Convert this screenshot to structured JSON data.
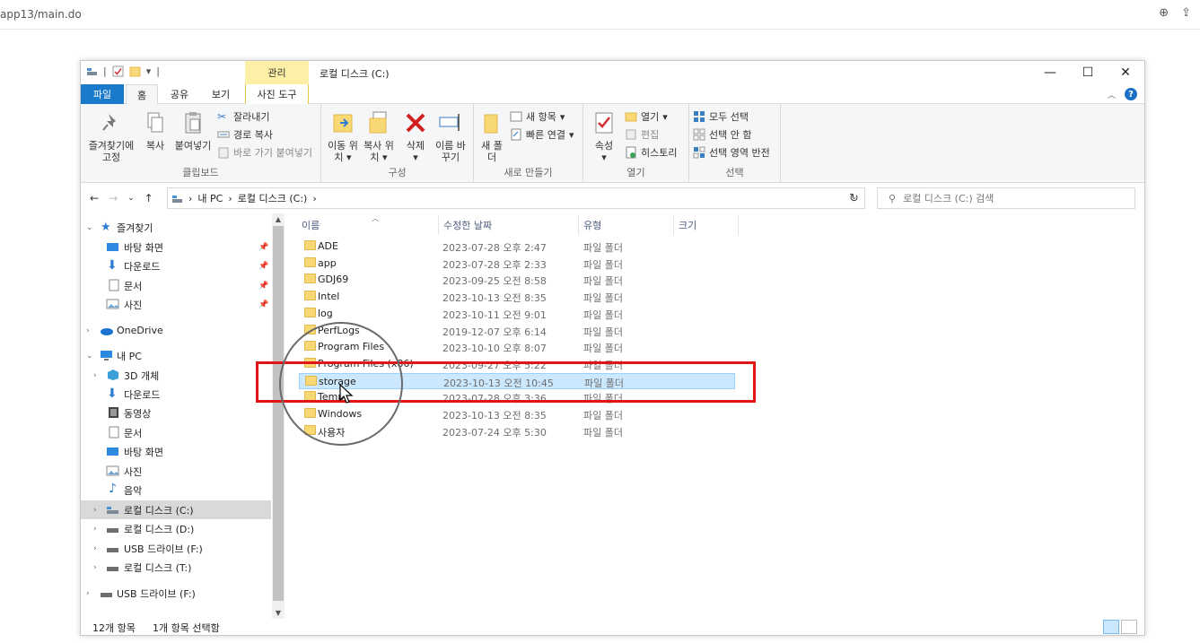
{
  "browser": {
    "url": "app13/main.do"
  },
  "window": {
    "title": "로컬 디스크 (C:)",
    "context_group": "관리",
    "tabs": {
      "file": "파일",
      "home": "홈",
      "share": "공유",
      "view": "보기",
      "photo_tools": "사진 도구"
    }
  },
  "ribbon": {
    "clipboard": {
      "pin_quick": "즐겨찾기에 고정",
      "copy": "복사",
      "paste": "붙여넣기",
      "cut": "잘라내기",
      "copy_path": "경로 복사",
      "paste_shortcut": "바로 가기 붙여넣기",
      "group": "클립보드"
    },
    "organize": {
      "move_to": "이동 위치",
      "copy_to": "복사 위치",
      "delete": "삭제",
      "rename": "이름 바꾸기",
      "group": "구성"
    },
    "new": {
      "new_folder": "새 폴더",
      "new_item": "새 항목",
      "easy_access": "빠른 연결",
      "group": "새로 만들기"
    },
    "open": {
      "properties": "속성",
      "open": "열기",
      "edit": "편집",
      "history": "히스토리",
      "group": "열기"
    },
    "select": {
      "select_all": "모두 선택",
      "select_none": "선택 안 함",
      "invert": "선택 영역 반전",
      "group": "선택"
    }
  },
  "address": {
    "crumbs": [
      "내 PC",
      "로컬 디스크 (C:)"
    ],
    "search_placeholder": "로컬 디스크 (C:) 검색"
  },
  "nav": {
    "quick_access": "즐겨찾기",
    "quick_items": [
      "바탕 화면",
      "다운로드",
      "문서",
      "사진"
    ],
    "onedrive": "OneDrive",
    "this_pc": "내 PC",
    "pc_items": [
      "3D 개체",
      "다운로드",
      "동영상",
      "문서",
      "바탕 화면",
      "사진",
      "음악",
      "로컬 디스크 (C:)",
      "로컬 디스크 (D:)",
      "USB 드라이브 (F:)",
      "로컬 디스크 (T:)"
    ],
    "usb": "USB 드라이브 (F:)"
  },
  "columns": {
    "name": "이름",
    "modified": "수정한 날짜",
    "type": "유형",
    "size": "크기"
  },
  "files": [
    {
      "name": "ADE",
      "date": "2023-07-28 오후 2:47",
      "type": "파일 폴더"
    },
    {
      "name": "app",
      "date": "2023-07-28 오후 2:33",
      "type": "파일 폴더"
    },
    {
      "name": "GDJ69",
      "date": "2023-09-25 오전 8:58",
      "type": "파일 폴더"
    },
    {
      "name": "Intel",
      "date": "2023-10-13 오전 8:35",
      "type": "파일 폴더"
    },
    {
      "name": "log",
      "date": "2023-10-11 오전 9:01",
      "type": "파일 폴더"
    },
    {
      "name": "PerfLogs",
      "date": "2019-12-07 오후 6:14",
      "type": "파일 폴더"
    },
    {
      "name": "Program Files",
      "date": "2023-10-10 오후 8:07",
      "type": "파일 폴더"
    },
    {
      "name": "Program Files (x86)",
      "date": "2023-09-27 오후 5:22",
      "type": "파일 폴더"
    },
    {
      "name": "storage",
      "date": "2023-10-13 오전 10:45",
      "type": "파일 폴더"
    },
    {
      "name": "Temp",
      "date": "2023-07-28 오후 3:36",
      "type": "파일 폴더"
    },
    {
      "name": "Windows",
      "date": "2023-10-13 오전 8:35",
      "type": "파일 폴더"
    },
    {
      "name": "사용자",
      "date": "2023-07-24 오후 5:30",
      "type": "파일 폴더"
    }
  ],
  "status": {
    "count": "12개 항목",
    "selected": "1개 항목 선택함"
  },
  "colors": {
    "accent": "#1979ca",
    "selection": "#cce8ff",
    "highlight_box": "#e01515"
  }
}
